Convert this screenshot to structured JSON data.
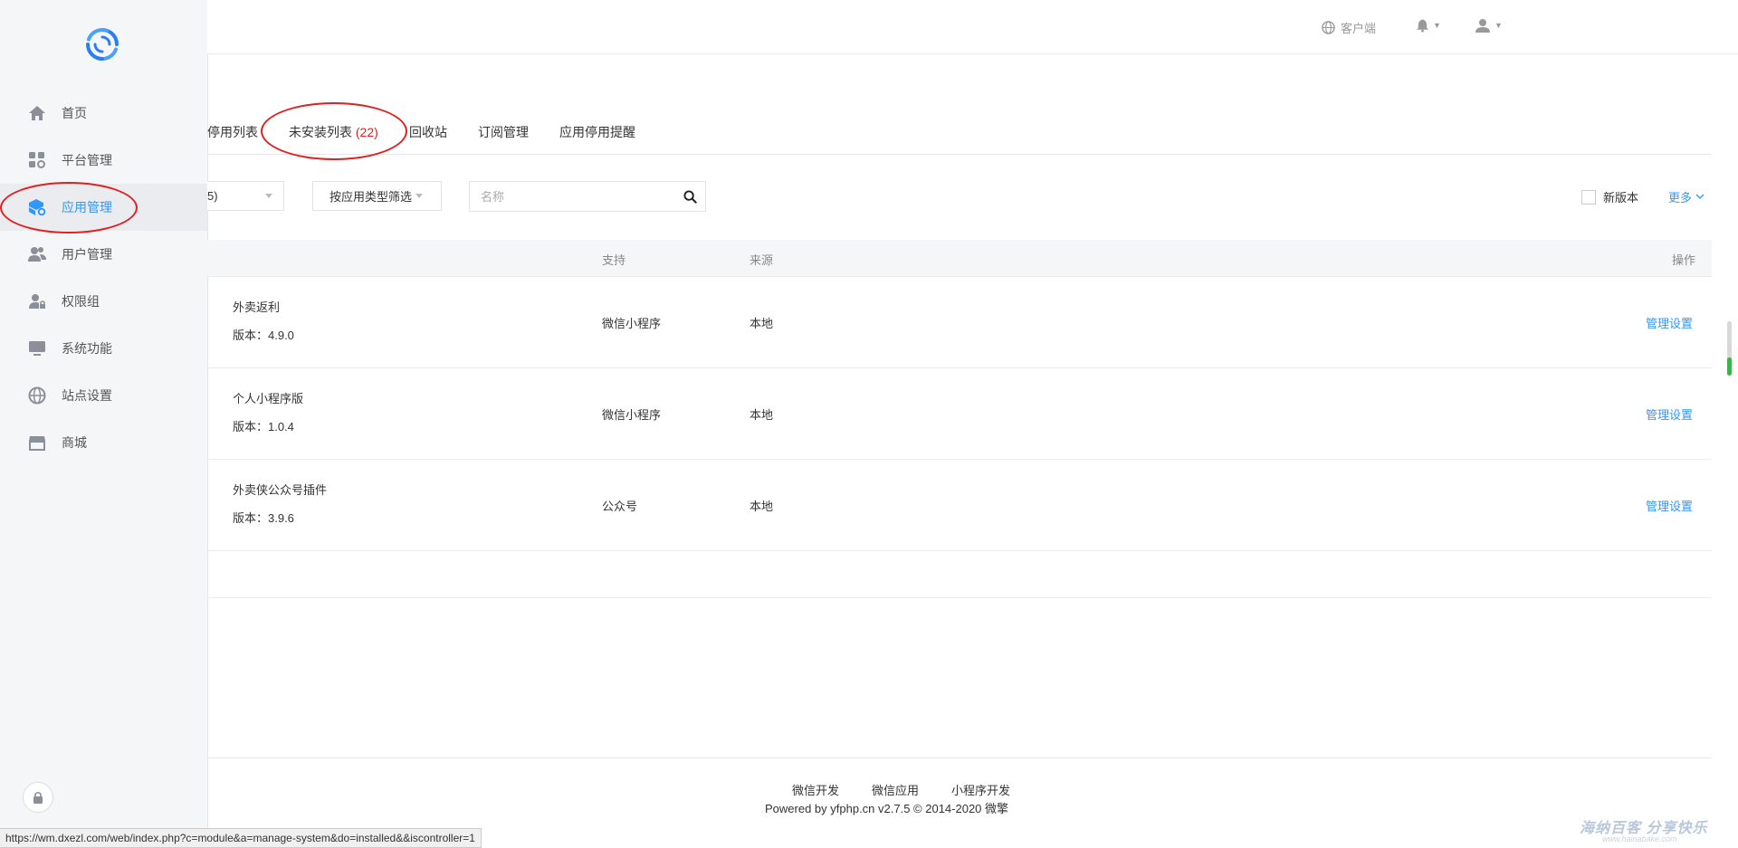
{
  "header": {
    "client_label": "客户端"
  },
  "sidebar": {
    "items": [
      {
        "label": "首页",
        "icon": "home-icon"
      },
      {
        "label": "平台管理",
        "icon": "grid-settings-icon"
      },
      {
        "label": "应用管理",
        "icon": "cube-settings-icon",
        "active": true
      },
      {
        "label": "用户管理",
        "icon": "users-icon"
      },
      {
        "label": "权限组",
        "icon": "user-lock-icon"
      },
      {
        "label": "系统功能",
        "icon": "monitor-icon"
      },
      {
        "label": "站点设置",
        "icon": "globe-icon"
      },
      {
        "label": "商城",
        "icon": "store-icon"
      }
    ]
  },
  "tabs": {
    "stopped_partial": "停用列表",
    "uninstalled_label": "未安装列表",
    "uninstalled_count": "(22)",
    "recycle": "回收站",
    "subscribe": "订阅管理",
    "stop_alert": "应用停用提醒"
  },
  "filters": {
    "first_select_partial": "5)",
    "type_filter": "按应用类型筛选",
    "search_placeholder": "名称",
    "new_version_label": "新版本",
    "more_label": "更多"
  },
  "table": {
    "columns": {
      "support": "支持",
      "source": "来源",
      "action": "操作"
    },
    "rows": [
      {
        "name": "外卖返利",
        "version": "版本：4.9.0",
        "support": "微信小程序",
        "source": "本地",
        "action": "管理设置"
      },
      {
        "name": "个人小程序版",
        "version": "版本：1.0.4",
        "support": "微信小程序",
        "source": "本地",
        "action": "管理设置"
      },
      {
        "name": "外卖侠公众号插件",
        "version": "版本：3.9.6",
        "support": "公众号",
        "source": "本地",
        "action": "管理设置"
      }
    ]
  },
  "footer": {
    "links": [
      "微信开发",
      "微信应用",
      "小程序开发"
    ],
    "powered": "Powered by yfphp.cn v2.7.5 © 2014-2020 微擎"
  },
  "status_url": "https://wm.dxezl.com/web/index.php?c=module&a=manage-system&do=installed&&iscontroller=1",
  "watermark": {
    "main": "海纳百客 分享快乐",
    "sub": "www.hainabake.com"
  },
  "colors": {
    "accent": "#3296fa",
    "annotation": "#e02020",
    "sidebar_bg": "#f5f6f8"
  }
}
